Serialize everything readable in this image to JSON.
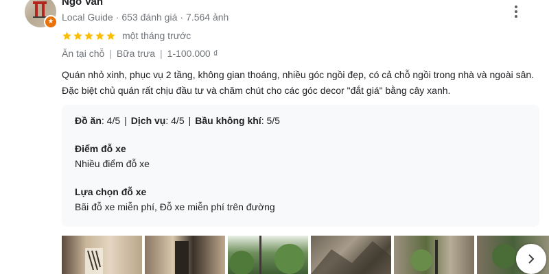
{
  "reviewer": {
    "name": "Ngo Van",
    "badge": "Local Guide",
    "review_count": "653 đánh giá",
    "photo_count": "7.564 ảnh",
    "avatar_badge_icon": "local-guide-star-icon",
    "guide_color": "#e8710a"
  },
  "review": {
    "rating": 5,
    "rating_max": 5,
    "star_color": "#fbbc04",
    "time": "một tháng trước",
    "tags": [
      "Ăn tại chỗ",
      "Bữa trưa",
      "1-100.000 ₫"
    ],
    "text": "Quán nhỏ xinh, phục vụ 2 tầng, không gian thoáng, nhiều góc ngồi đẹp, có cả chỗ ngồi trong nhà và ngoài sân. Đặc biệt chủ quán rất chịu đầu tư và chăm chút cho các góc decor \"đắt giá\" bằng cây xanh."
  },
  "scores": [
    {
      "label": "Đồ ăn",
      "value": "4/5"
    },
    {
      "label": "Dịch vụ",
      "value": "4/5"
    },
    {
      "label": "Bầu không khí",
      "value": "5/5"
    }
  ],
  "attributes": [
    {
      "label": "Điểm đỗ xe",
      "value": "Nhiều điểm đỗ xe"
    },
    {
      "label": "Lựa chọn đỗ xe",
      "value": "Bãi đỗ xe miễn phí, Đỗ xe miễn phí trên đường"
    }
  ],
  "photos": {
    "count_visible": 6
  },
  "icons": {
    "more": "more-vert-icon",
    "next": "chevron-right-icon",
    "star": "star-icon"
  }
}
